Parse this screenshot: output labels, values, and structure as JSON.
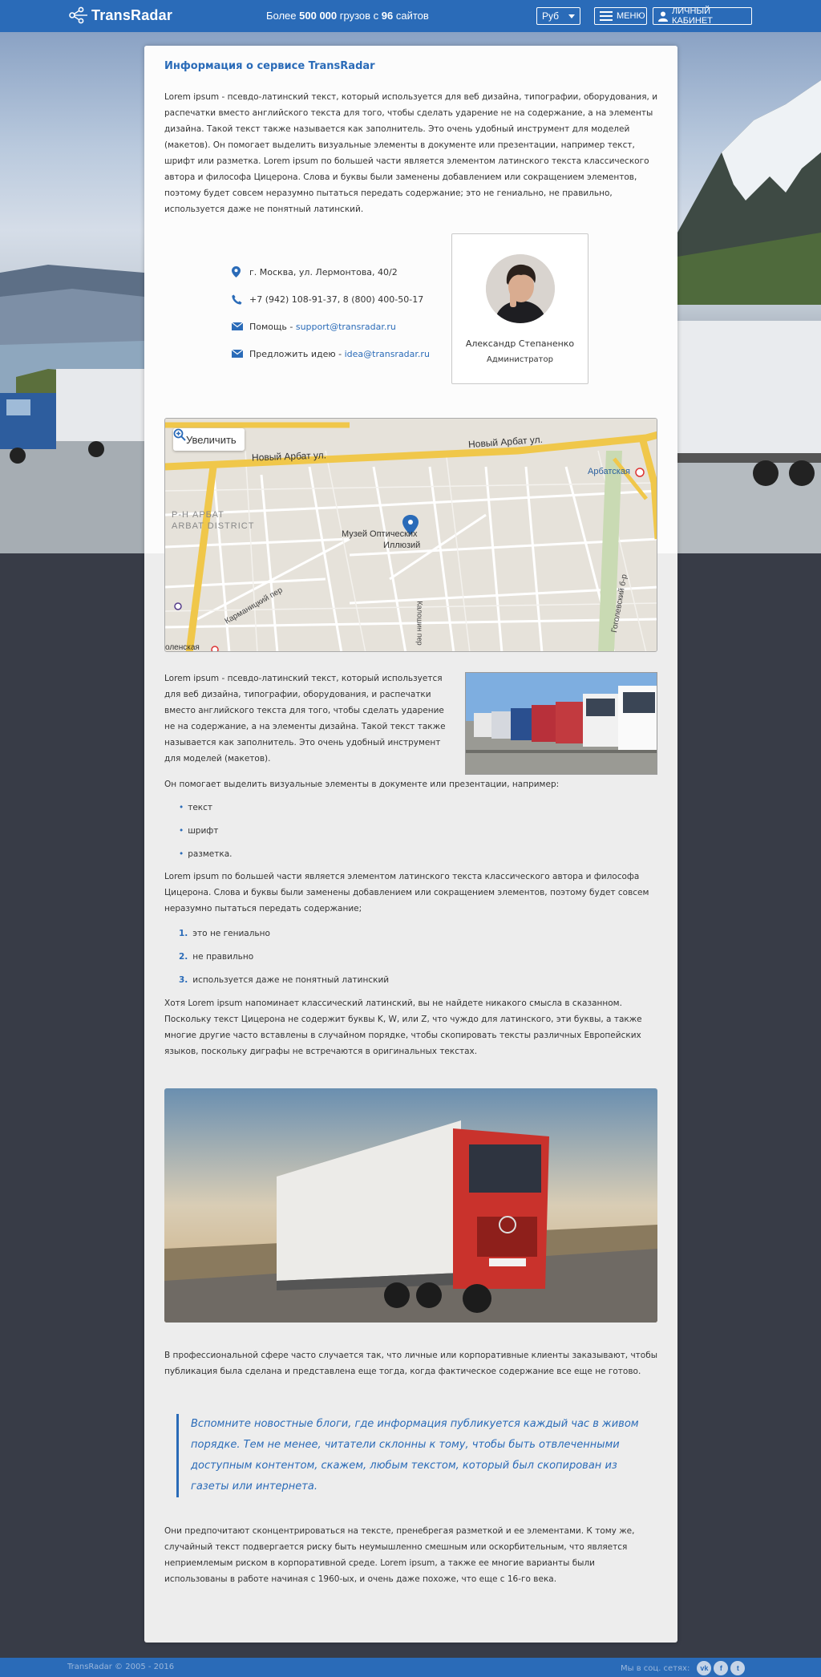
{
  "header": {
    "logo": "TransRadar",
    "tagline_prefix": "Более ",
    "tagline_count1": "500 000",
    "tagline_middle": " грузов с ",
    "tagline_count2": "96",
    "tagline_suffix": " сайтов",
    "currency": "Руб",
    "menu_label": "МЕНЮ",
    "cabinet_label": "ЛИЧНЫЙ КАБИНЕТ"
  },
  "info": {
    "title": "Информация о сервисе TransRadar",
    "intro": "Lorem ipsum - псевдо-латинский текст, который используется для веб дизайна, типографии, оборудования, и распечатки вместо английского текста для того, чтобы сделать ударение не на содержание, а на элементы дизайна. Такой текст также называется как заполнитель. Это очень удобный инструмент для моделей (макетов). Он помогает выделить визуальные элементы в документе или презентации, например текст, шрифт или разметка. Lorem ipsum по большей части является элементом латинского текста классического автора и философа Цицерона. Слова и буквы были заменены добавлением или сокращением элементов, поэтому будет совсем неразумно пытаться передать содержание; это не гениально, не правильно, используется даже не понятный латинский."
  },
  "contacts": {
    "address": "г. Москва, ул. Лермонтова, 40/2",
    "phone": "+7 (942) 108-91-37, 8 (800) 400-50-17",
    "help_label": "Помощь - ",
    "help_email": "support@transradar.ru",
    "idea_label": "Предложить идею - ",
    "idea_email": "idea@transradar.ru"
  },
  "person": {
    "name": "Александр Степаненко",
    "role": "Администратор"
  },
  "map": {
    "zoom_label": "Увеличить",
    "street1": "Новый Арбат ул.",
    "street2": "Новый Арбат ул.",
    "metro1": "Арбатская",
    "district1": "Р-Н АРБАТ",
    "district2": "ARBAT DISTRICT",
    "poi1": "Музей Оптических",
    "poi2": "Иллюзий",
    "street3": "Карманицкий пер",
    "street4": "Калошин пер",
    "street5": "Гоголевский б-р",
    "metro2": "оленская"
  },
  "content": {
    "p2": "Lorem ipsum - псевдо-латинский текст, который используется для веб дизайна, типографии, оборудования, и распечатки вместо английского текста для того, чтобы сделать ударение не на содержание, а на элементы дизайна. Такой текст также называется как заполнитель. Это очень удобный инструмент для моделей (макетов).",
    "p3": "Он помогает выделить визуальные элементы в документе или презентации, например:",
    "ul": [
      "текст",
      "шрифт",
      "разметка."
    ],
    "p4": "Lorem ipsum по большей части является элементом латинского текста классического автора и философа Цицерона. Слова и буквы были заменены добавлением или сокращением элементов, поэтому будет совсем неразумно пытаться передать содержание;",
    "ol": [
      "это не гениально",
      "не правильно",
      "используется даже не понятный латинский"
    ],
    "ol_nums": [
      "1.",
      "2.",
      "3."
    ],
    "p5": "Хотя Lorem ipsum напоминает классический латинский, вы не найдете никакого смысла в сказанном. Поскольку текст Цицерона не содержит буквы K, W, или Z, что чуждо для латинского, эти буквы, а также многие другие часто вставлены в случайном порядке, чтобы скопировать тексты различных Европейских языков, поскольку диграфы не встречаются в оригинальных текстах.",
    "p6": "В профессиональной сфере часто случается так, что личные или корпоративные клиенты заказывают, чтобы публикация была сделана и представлена еще тогда, когда фактическое содержание все еще не готово.",
    "quote": "Вспомните новостные блоги, где информация публикуется каждый час в живом порядке. Тем не менее, читатели склонны к тому, чтобы быть отвлеченными доступным контентом, скажем, любым текстом, который был скопирован из газеты или интернета.",
    "p7": "Они предпочитают сконцентрироваться на тексте, пренебрегая разметкой и ее элементами. К тому же, случайный текст подвергается риску быть неумышленно смешным или оскорбительным, что является неприемлемым риском в корпоративной среде. Lorem ipsum, а также ее многие варианты были использованы в работе начиная с 1960-ых, и очень даже похоже, что еще с 16-го века."
  },
  "footer": {
    "copyright": "TransRadar © 2005 - 2016",
    "social_label": "Мы в соц. сетях:"
  },
  "colors": {
    "brand": "#2a6bb8",
    "background": "#383c47"
  }
}
